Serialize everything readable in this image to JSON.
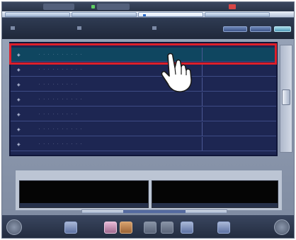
{
  "titlebar": {
    "left_text": "",
    "center_text": "",
    "right_text": ""
  },
  "tabs": [
    "",
    "",
    "",
    ""
  ],
  "toolbar": {
    "tools": [
      "",
      "",
      ""
    ],
    "right_buttons": [
      "",
      ""
    ]
  },
  "list": {
    "rows": [
      {
        "name": "· · · · ·  ·  ·  · · ·",
        "selected": true
      },
      {
        "name": "· · · · ·  ·  ·  · · ·",
        "selected": false
      },
      {
        "name": "· · · · ·  ·  ·  · ·",
        "selected": false
      },
      {
        "name": "· · · ·  · · · ·  · ·",
        "selected": false
      },
      {
        "name": "· · · ·  ·  ·  · · ·",
        "selected": false
      },
      {
        "name": "· · · · ·  ·  ·  · · ·",
        "selected": false
      },
      {
        "name": "· · · ·  ·  · · ·  · ·",
        "selected": false
      }
    ],
    "scroll_position": 0.4
  },
  "panel": {
    "tab_label": "",
    "left": {
      "label_top": "",
      "value_top": "",
      "label_bottom": ""
    },
    "right": {
      "label_top": "",
      "value_top": "",
      "label_bottom": ""
    }
  },
  "colors": {
    "highlight": "#dd1f2a",
    "list_bg": "#1d2652",
    "selected_row": "#0f4660"
  },
  "icons": {
    "row": "document-icon",
    "pointer": "hand-pointer-icon",
    "bottom": [
      "home-icon",
      "grid-icon",
      "image-icon",
      "image-icon",
      "blank-icon",
      "blank-icon",
      "menu-icon",
      "list-icon",
      "power-icon"
    ]
  }
}
